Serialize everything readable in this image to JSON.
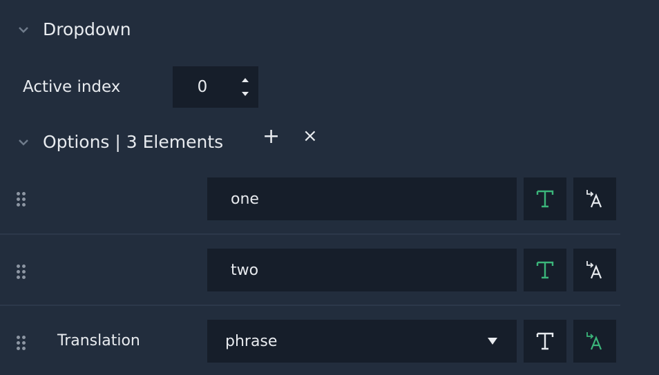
{
  "dropdown_section": {
    "title": "Dropdown",
    "active_index_label": "Active index",
    "active_index_value": "0"
  },
  "options_section": {
    "title": "Options | 3 Elements",
    "add_icon": "+",
    "remove_icon": "×"
  },
  "options": [
    {
      "value": "one",
      "type": "text"
    },
    {
      "value": "two",
      "type": "text"
    },
    {
      "label": "Translation",
      "value": "phrase",
      "type": "translation"
    }
  ],
  "colors": {
    "background": "#222d3d",
    "field": "#161e2a",
    "accent_green": "#3bb67a",
    "text": "#e8ebef"
  },
  "icons": {
    "text_mode": "text-T-icon",
    "translation_mode": "translate-A-icon"
  }
}
